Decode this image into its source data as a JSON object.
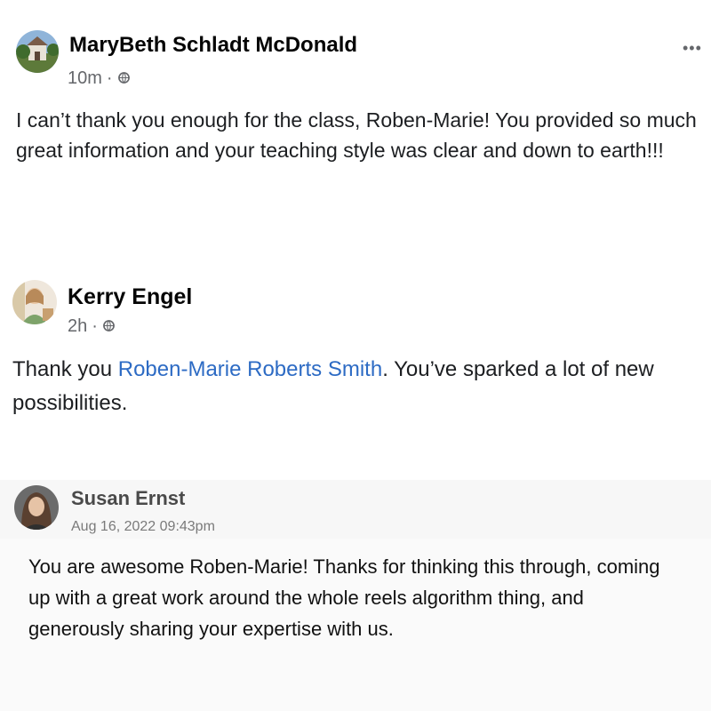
{
  "posts": [
    {
      "author": "MaryBeth Schladt McDonald",
      "time": "10m",
      "separator": "·",
      "body": "I can’t thank you enough for the class, Roben-Marie!  You provided so much great information and your teaching style was clear and down to earth!!!",
      "more_icon": "more-horizontal-icon",
      "audience_icon": "globe-icon"
    },
    {
      "author": "Kerry Engel",
      "time": "2h",
      "separator": "·",
      "body_prefix": "Thank you ",
      "mention": "Roben-Marie Roberts Smith",
      "body_suffix": ". You’ve sparked a lot of new possibilities.",
      "audience_icon": "globe-icon"
    },
    {
      "author": "Susan Ernst",
      "date": "Aug 16, 2022 09:43pm",
      "body": "You are awesome Roben-Marie!  Thanks for thinking this through, coming up with a great work around the whole reels algorithm thing, and generously sharing your expertise with us."
    }
  ],
  "colors": {
    "link": "#2d6bc4",
    "meta": "#65676b",
    "card_bg": "#f7f7f7"
  }
}
